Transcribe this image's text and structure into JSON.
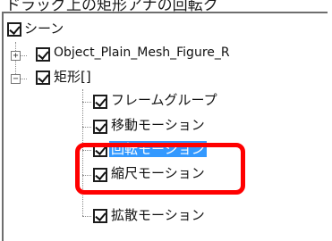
{
  "caption": "ドラッグ上の矩形アナの回転ク",
  "tree": {
    "root": {
      "label": "シーン",
      "checked": true
    },
    "children": [
      {
        "label": "Object_Plain_Mesh_Figure_R",
        "checked": true,
        "expander": "+"
      },
      {
        "label": "矩形[]",
        "checked": true,
        "expander": "−"
      }
    ],
    "rect_children": [
      {
        "label": "フレームグループ",
        "checked": true
      },
      {
        "label": "移動モーション",
        "checked": true
      },
      {
        "label": "回転モーション",
        "checked": true,
        "selected": true
      },
      {
        "label": "縮尺モーション",
        "checked": true
      },
      {
        "label": "拡散モーション",
        "checked": true
      }
    ]
  },
  "colors": {
    "selection": "#3399ff",
    "highlight_border": "#ff0000"
  }
}
